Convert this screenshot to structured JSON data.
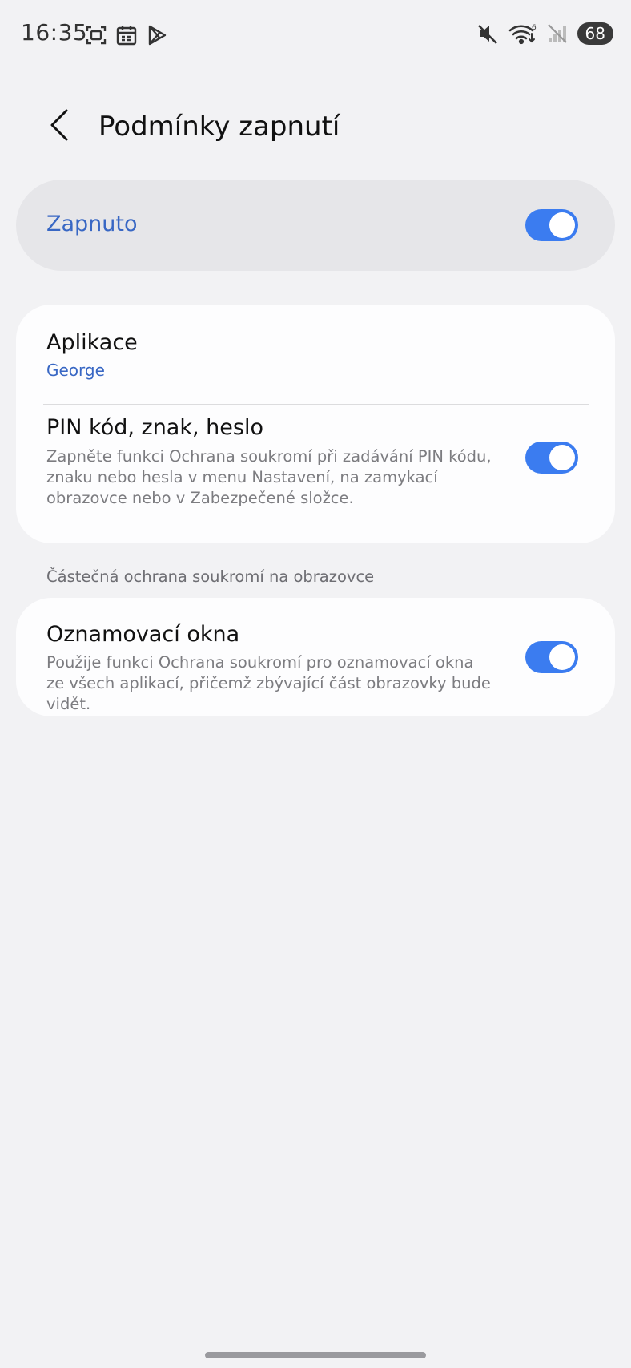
{
  "status_bar": {
    "time": "16:35",
    "battery": "68",
    "left_icons": [
      "screenshot-icon",
      "calendar-icon",
      "play-store-icon"
    ],
    "right_icons": [
      "mute-icon",
      "wifi-icon",
      "signal-icon"
    ]
  },
  "header": {
    "title": "Podmínky zapnutí",
    "back_icon": "chevron-left-icon"
  },
  "master_switch": {
    "label": "Zapnuto",
    "on": true
  },
  "settings": {
    "app": {
      "title": "Aplikace",
      "value": "George"
    },
    "pin": {
      "title": "PIN kód, znak, heslo",
      "description": "Zapněte funkci Ochrana soukromí při zadávání PIN kódu, znaku nebo hesla v menu Nastavení, na zamykací obrazovce nebo v Zabezpečené složce.",
      "on": true
    }
  },
  "partial_section": {
    "header": "Částečná ochrana soukromí na obrazovce",
    "notifications": {
      "title": "Oznamovací okna",
      "description": "Použije funkci Ochrana soukromí pro oznamovací okna ze všech aplikací, přičemž zbývající část obrazovky bude vidět.",
      "on": true
    }
  },
  "colors": {
    "accent": "#3b7cf0",
    "accent_text": "#3867c4",
    "background": "#f2f2f4"
  }
}
